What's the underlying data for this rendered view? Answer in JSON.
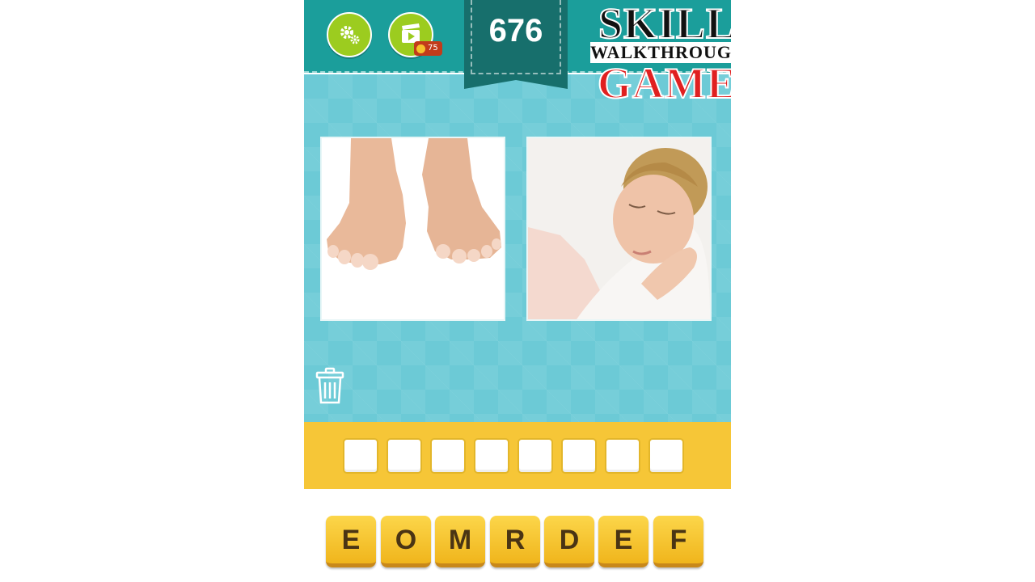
{
  "header": {
    "level": "676",
    "video_coin_count": "75",
    "settings_icon": "gear-icon",
    "video_icon": "film-clapper-icon"
  },
  "logo": {
    "line1": "SKILL",
    "line2": "WALKTHROUGH",
    "line3": "GAME"
  },
  "clues": [
    {
      "name": "bare-feet-photo"
    },
    {
      "name": "sleeping-woman-photo"
    }
  ],
  "answer": {
    "slot_count": 8
  },
  "letters": [
    "E",
    "O",
    "M",
    "R",
    "D",
    "E",
    "F"
  ],
  "colors": {
    "topbar": "#1b9e9b",
    "playfield": "#6ccad6",
    "answer_bar": "#f6c637",
    "button_green": "#9ccc1f",
    "key_yellow": "#f6c637"
  }
}
